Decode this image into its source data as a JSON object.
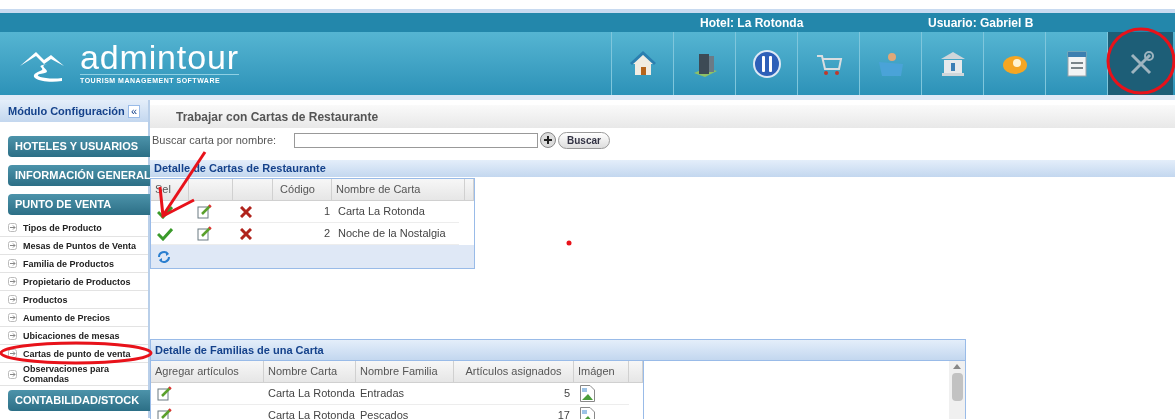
{
  "header": {
    "hotel": "Hotel: La Rotonda",
    "user": "Usuario: Gabriel B"
  },
  "logo": {
    "name": "admintour",
    "tagline": "TOURISM MANAGEMENT SOFTWARE"
  },
  "nav": [
    {
      "kind": "home",
      "selected": false
    },
    {
      "kind": "building",
      "selected": false
    },
    {
      "kind": "restaurant",
      "selected": false
    },
    {
      "kind": "cart",
      "selected": false
    },
    {
      "kind": "person",
      "selected": false
    },
    {
      "kind": "bank",
      "selected": false
    },
    {
      "kind": "piggy",
      "selected": false
    },
    {
      "kind": "document",
      "selected": false
    },
    {
      "kind": "tools",
      "selected": true
    }
  ],
  "sidebar": {
    "title": "Módulo Configuración",
    "collapse": "«",
    "blocks": [
      {
        "kind": "section",
        "label": "HOTELES Y USUARIOS"
      },
      {
        "kind": "section",
        "label": "INFORMACIÓN GENERAL"
      },
      {
        "kind": "section",
        "label": "PUNTO DE VENTA"
      },
      {
        "kind": "link",
        "label": "Tipos de Producto"
      },
      {
        "kind": "link",
        "label": "Mesas de Puntos de Venta"
      },
      {
        "kind": "link",
        "label": "Familia de Productos"
      },
      {
        "kind": "link",
        "label": "Propietario de Productos"
      },
      {
        "kind": "link",
        "label": "Productos"
      },
      {
        "kind": "link",
        "label": "Aumento de Precios"
      },
      {
        "kind": "link",
        "label": "Ubicaciones de mesas"
      },
      {
        "kind": "link",
        "label": "Cartas de punto de venta"
      },
      {
        "kind": "link",
        "label": "Observaciones para Comandas"
      },
      {
        "kind": "section",
        "label": "CONTABILIDAD/STOCK"
      }
    ]
  },
  "page": {
    "title": "Trabajar con Cartas de Restaurante",
    "search_label": "Buscar carta por nombre:",
    "search_button": "Buscar"
  },
  "cartas": {
    "title": "Detalle de Cartas de Restaurante",
    "columns": [
      "Sel",
      "Código",
      "Nombre de Carta"
    ],
    "rows": [
      {
        "code": "1",
        "name": "Carta La Rotonda"
      },
      {
        "code": "2",
        "name": "Noche de la Nostalgia"
      }
    ]
  },
  "familias": {
    "title": "Detalle de Familias de una Carta",
    "columns": [
      "Agregar artículos",
      "Nombre Carta",
      "Nombre Familia",
      "Artículos asignados",
      "Imágen"
    ],
    "rows": [
      {
        "carta": "Carta La Rotonda",
        "familia": "Entradas",
        "count": "5"
      },
      {
        "carta": "Carta La Rotonda",
        "familia": "Pescados",
        "count": "17"
      }
    ]
  }
}
